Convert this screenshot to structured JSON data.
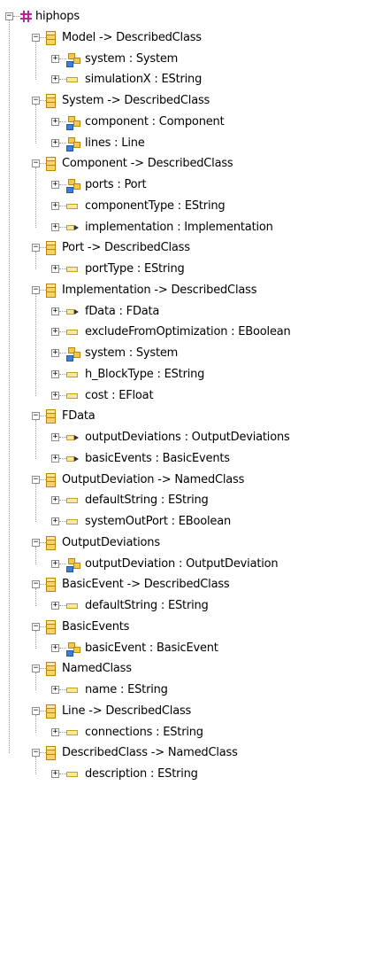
{
  "tree": {
    "root": {
      "label": "hiphops",
      "icon": "package-icon",
      "expanded": true
    },
    "classes": [
      {
        "label": "Model -> DescribedClass",
        "features": [
          {
            "label": "system : System",
            "kind": "containment"
          },
          {
            "label": "simulationX : EString",
            "kind": "attribute"
          }
        ]
      },
      {
        "label": "System -> DescribedClass",
        "features": [
          {
            "label": "component : Component",
            "kind": "containment"
          },
          {
            "label": "lines : Line",
            "kind": "containment"
          }
        ]
      },
      {
        "label": "Component -> DescribedClass",
        "features": [
          {
            "label": "ports : Port",
            "kind": "containment"
          },
          {
            "label": "componentType : EString",
            "kind": "attribute"
          },
          {
            "label": "implementation : Implementation",
            "kind": "reference"
          }
        ]
      },
      {
        "label": "Port -> DescribedClass",
        "features": [
          {
            "label": "portType : EString",
            "kind": "attribute"
          }
        ]
      },
      {
        "label": "Implementation -> DescribedClass",
        "features": [
          {
            "label": "fData : FData",
            "kind": "reference"
          },
          {
            "label": "excludeFromOptimization : EBoolean",
            "kind": "attribute"
          },
          {
            "label": "system : System",
            "kind": "containment"
          },
          {
            "label": "h_BlockType : EString",
            "kind": "attribute"
          },
          {
            "label": "cost : EFloat",
            "kind": "attribute"
          }
        ]
      },
      {
        "label": "FData",
        "features": [
          {
            "label": "outputDeviations : OutputDeviations",
            "kind": "reference"
          },
          {
            "label": "basicEvents : BasicEvents",
            "kind": "reference"
          }
        ]
      },
      {
        "label": "OutputDeviation -> NamedClass",
        "features": [
          {
            "label": "defaultString : EString",
            "kind": "attribute"
          },
          {
            "label": "systemOutPort : EBoolean",
            "kind": "attribute"
          }
        ]
      },
      {
        "label": "OutputDeviations",
        "features": [
          {
            "label": "outputDeviation : OutputDeviation",
            "kind": "containment"
          }
        ]
      },
      {
        "label": "BasicEvent -> DescribedClass",
        "features": [
          {
            "label": "defaultString : EString",
            "kind": "attribute"
          }
        ]
      },
      {
        "label": "BasicEvents",
        "features": [
          {
            "label": "basicEvent : BasicEvent",
            "kind": "containment"
          }
        ]
      },
      {
        "label": "NamedClass",
        "features": [
          {
            "label": "name : EString",
            "kind": "attribute"
          }
        ]
      },
      {
        "label": "Line -> DescribedClass",
        "features": [
          {
            "label": "connections : EString",
            "kind": "attribute"
          }
        ]
      },
      {
        "label": "DescribedClass -> NamedClass",
        "features": [
          {
            "label": "description : EString",
            "kind": "attribute"
          }
        ]
      }
    ]
  },
  "toggle_symbols": {
    "expanded": "−",
    "collapsed": "+"
  },
  "colors": {
    "package": "#c0209a",
    "class": "#f5d36a",
    "attribute": "#f7e7a2",
    "containment_blue": "#3d7fd6"
  }
}
